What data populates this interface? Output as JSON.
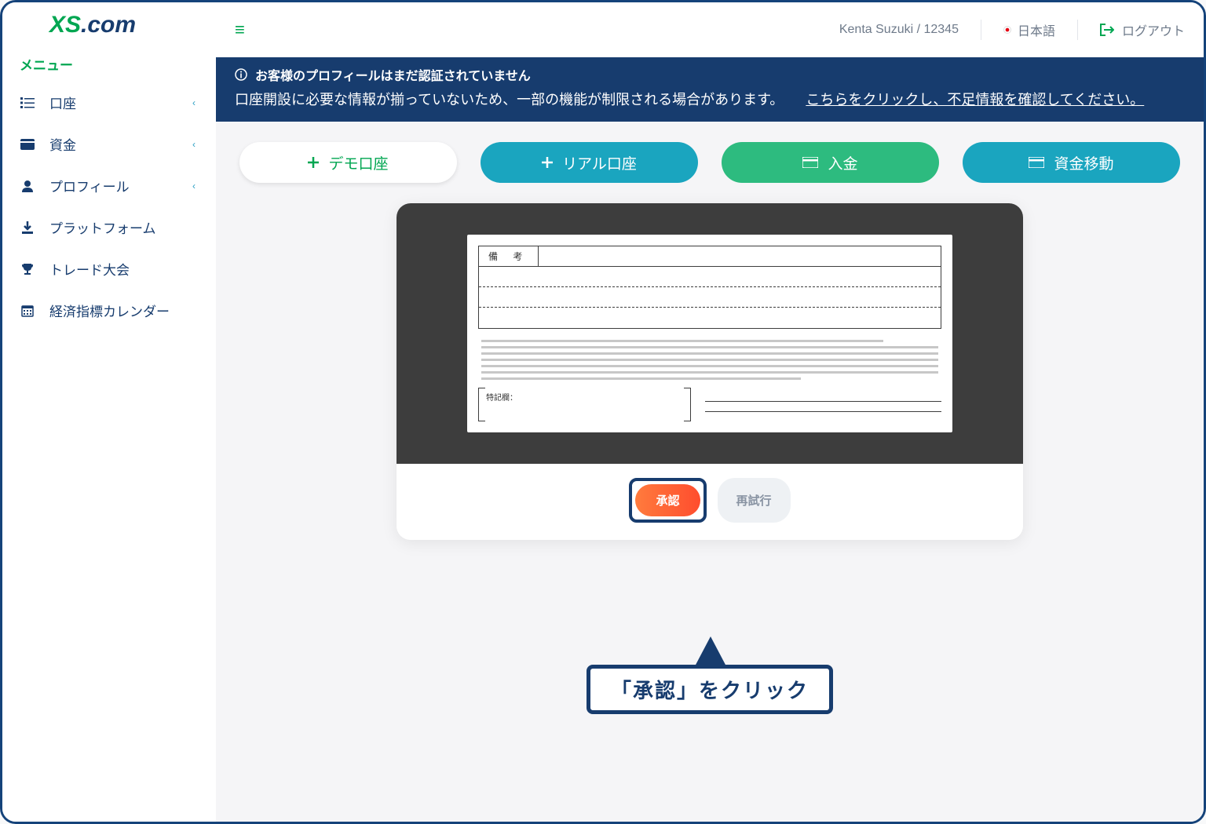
{
  "logo": {
    "part1": "XS",
    "part2": ".com"
  },
  "sidebar": {
    "menu_title": "メニュー",
    "items": [
      {
        "label": "口座",
        "has_chevron": true
      },
      {
        "label": "資金",
        "has_chevron": true
      },
      {
        "label": "プロフィール",
        "has_chevron": true
      },
      {
        "label": "プラットフォーム",
        "has_chevron": false
      },
      {
        "label": "トレード大会",
        "has_chevron": false
      },
      {
        "label": "経済指標カレンダー",
        "has_chevron": false
      }
    ]
  },
  "topbar": {
    "user": "Kenta Suzuki / 12345",
    "language": "日本語",
    "logout": "ログアウト"
  },
  "notice": {
    "title": "お客様のプロフィールはまだ認証されていません",
    "body_text": "口座開設に必要な情報が揃っていないため、一部の機能が制限される場合があります。",
    "link_text": "こちらをクリックし、不足情報を確認してください。"
  },
  "actions": {
    "demo": "デモ口座",
    "real": "リアル口座",
    "deposit": "入金",
    "transfer": "資金移動"
  },
  "document": {
    "remarks_label": "備  考",
    "notes_label": "特記欄："
  },
  "preview_buttons": {
    "approve": "承認",
    "retry": "再試行"
  },
  "callout": "「承認」をクリック"
}
